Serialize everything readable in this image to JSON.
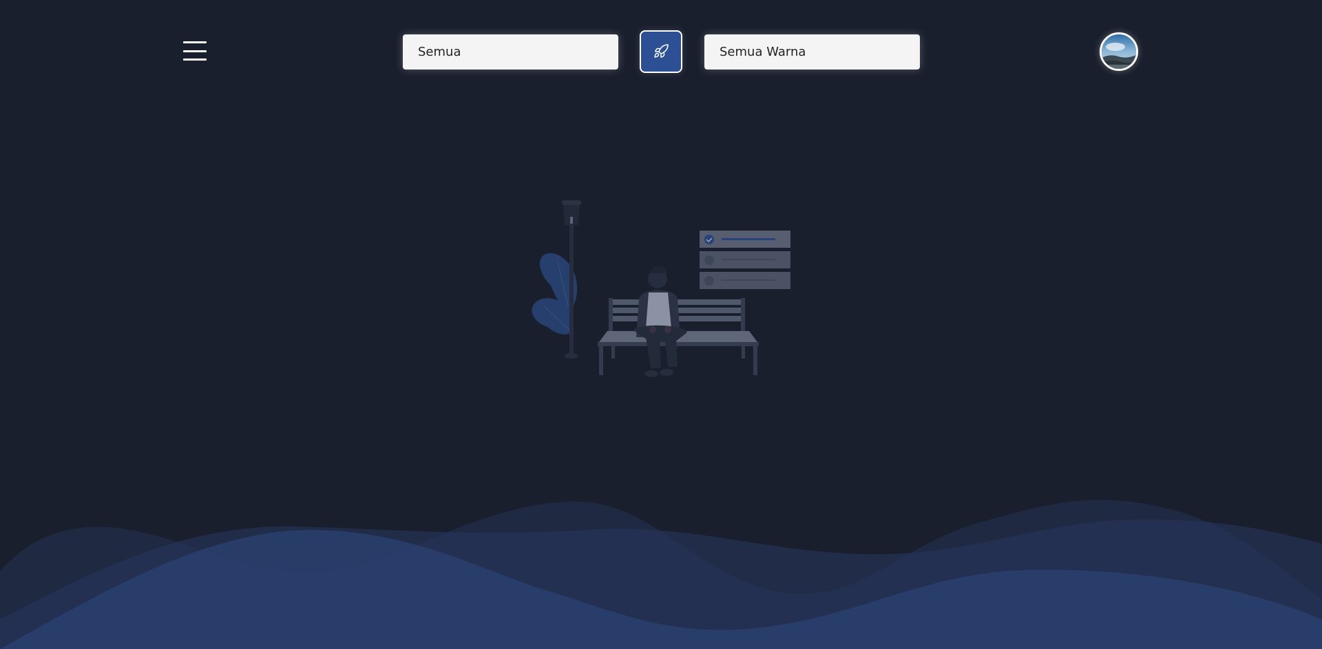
{
  "header": {
    "menu_icon": "hamburger-menu-icon",
    "category_select": {
      "value": "Semua"
    },
    "submit_icon": "rocket-icon",
    "color_select": {
      "value": "Semua Warna"
    },
    "avatar_icon": "user-avatar"
  },
  "empty_state": {
    "illustration": "person-on-bench-empty-illustration"
  },
  "colors": {
    "background": "#1a1f2d",
    "accent": "#2d4f94",
    "wave": "#2a3f6e"
  }
}
